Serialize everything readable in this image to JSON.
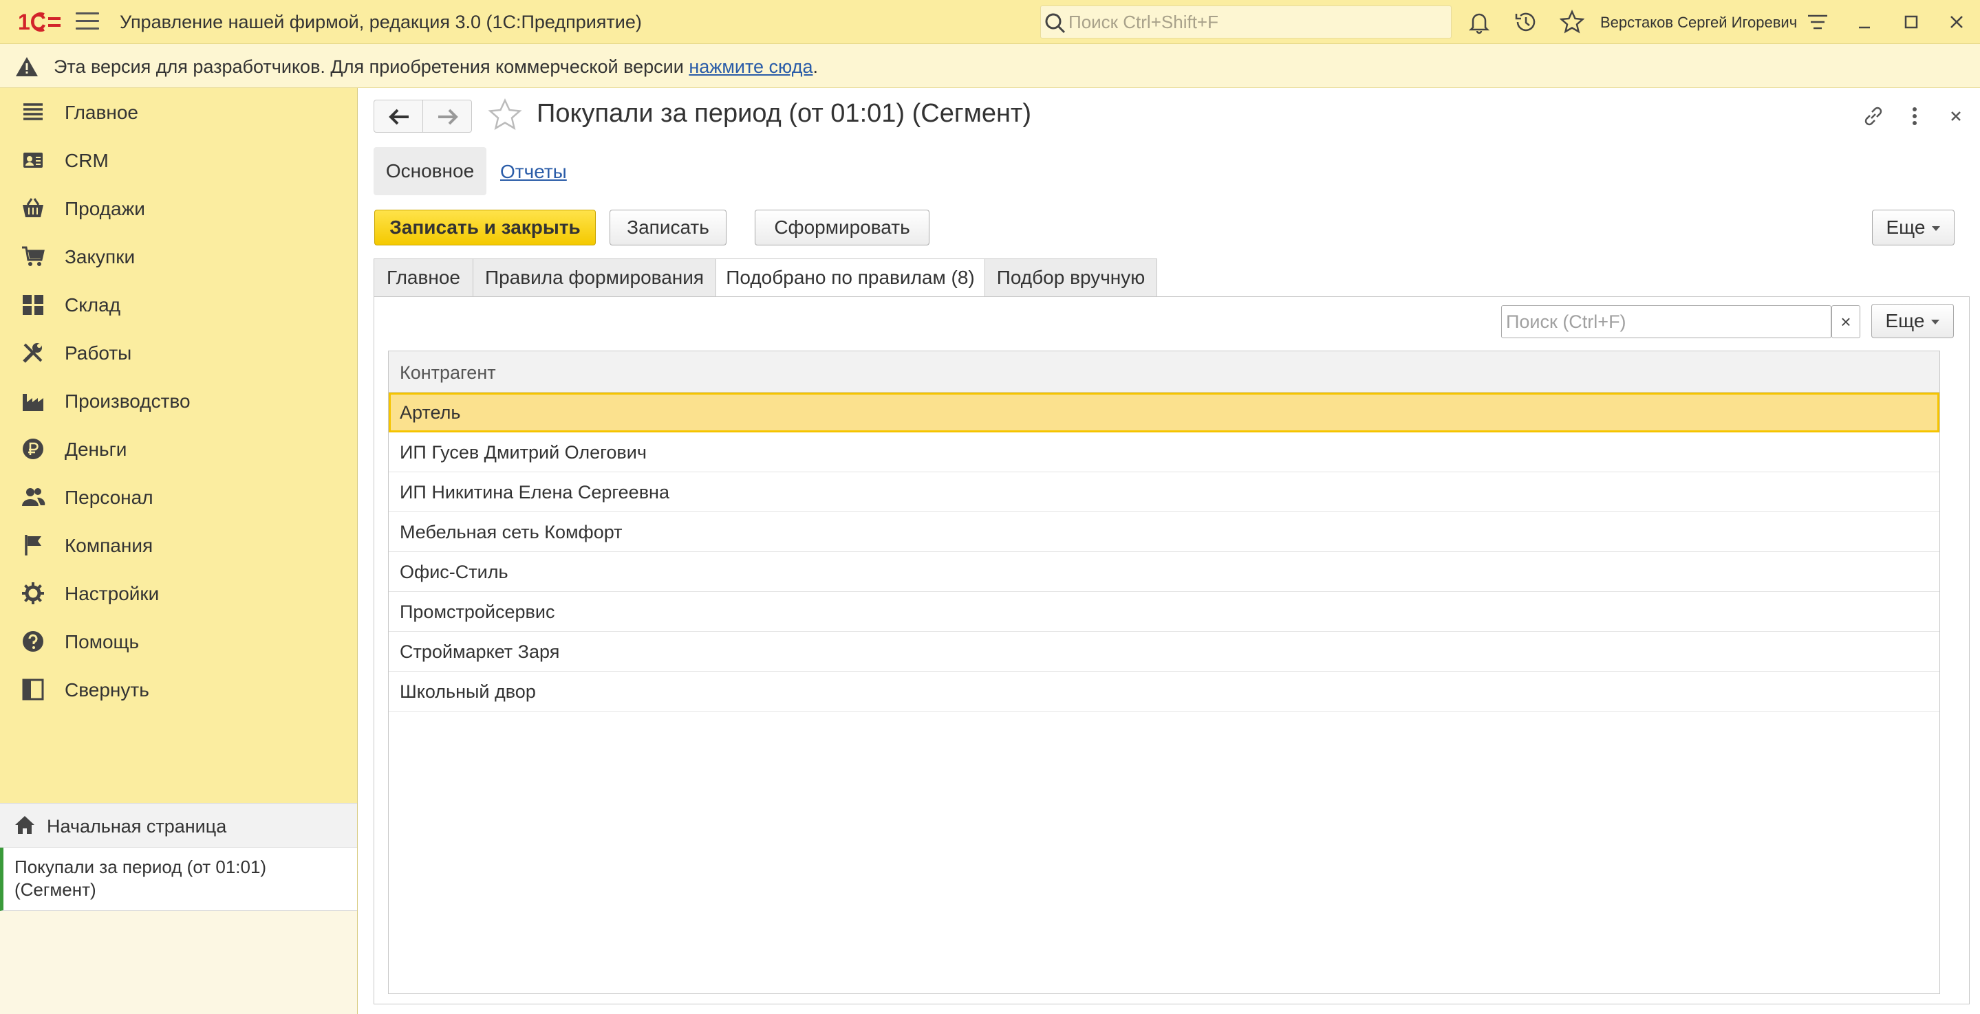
{
  "titlebar": {
    "logo_text": "1С",
    "app_title": "Управление нашей фирмой, редакция 3.0  (1С:Предприятие)",
    "search_placeholder": "Поиск Ctrl+Shift+F",
    "user_name": "Верстаков Сергей Игоревич"
  },
  "banner": {
    "message": "Эта версия для разработчиков. Для приобретения коммерческой версии ",
    "link_text": "нажмите сюда",
    "suffix": "."
  },
  "sidebar": {
    "items": [
      {
        "label": "Главное",
        "icon": "list-icon"
      },
      {
        "label": "CRM",
        "icon": "contacts-icon"
      },
      {
        "label": "Продажи",
        "icon": "basket-icon"
      },
      {
        "label": "Закупки",
        "icon": "cart-icon"
      },
      {
        "label": "Склад",
        "icon": "warehouse-icon"
      },
      {
        "label": "Работы",
        "icon": "tools-icon"
      },
      {
        "label": "Производство",
        "icon": "factory-icon"
      },
      {
        "label": "Деньги",
        "icon": "ruble-icon"
      },
      {
        "label": "Персонал",
        "icon": "people-icon"
      },
      {
        "label": "Компания",
        "icon": "flag-icon"
      },
      {
        "label": "Настройки",
        "icon": "gear-icon"
      },
      {
        "label": "Помощь",
        "icon": "help-icon"
      },
      {
        "label": "Свернуть",
        "icon": "collapse-icon"
      }
    ],
    "home": "Начальная страница",
    "open_document": "Покупали за период (от 01:01) (Сегмент)"
  },
  "form": {
    "title": "Покупали за период (от 01:01) (Сегмент)",
    "section_tabs": {
      "main": "Основное",
      "reports": "Отчеты"
    },
    "buttons": {
      "save_close": "Записать и закрыть",
      "save": "Записать",
      "generate": "Сформировать",
      "more": "Еще"
    },
    "tabs": [
      "Главное",
      "Правила формирования",
      "Подобрано по правилам (8)",
      "Подбор вручную"
    ],
    "active_tab": 2,
    "list": {
      "search_placeholder": "Поиск (Ctrl+F)",
      "clear": "×",
      "more": "Еще",
      "column": "Контрагент",
      "rows": [
        "Артель",
        "ИП Гусев Дмитрий Олегович",
        "ИП Никитина Елена Сергеевна",
        "Мебельная сеть Комфорт",
        "Офис-Стиль",
        "Промстройсервис",
        "Строймаркет Заря",
        "Школьный двор"
      ],
      "selected_row": 0
    }
  },
  "colors": {
    "accent_yellow": "#fbeda0",
    "primary_button": "#f4c900",
    "selection": "#fbe18e",
    "link": "#2a5ca8",
    "logo_red": "#d2232a"
  }
}
